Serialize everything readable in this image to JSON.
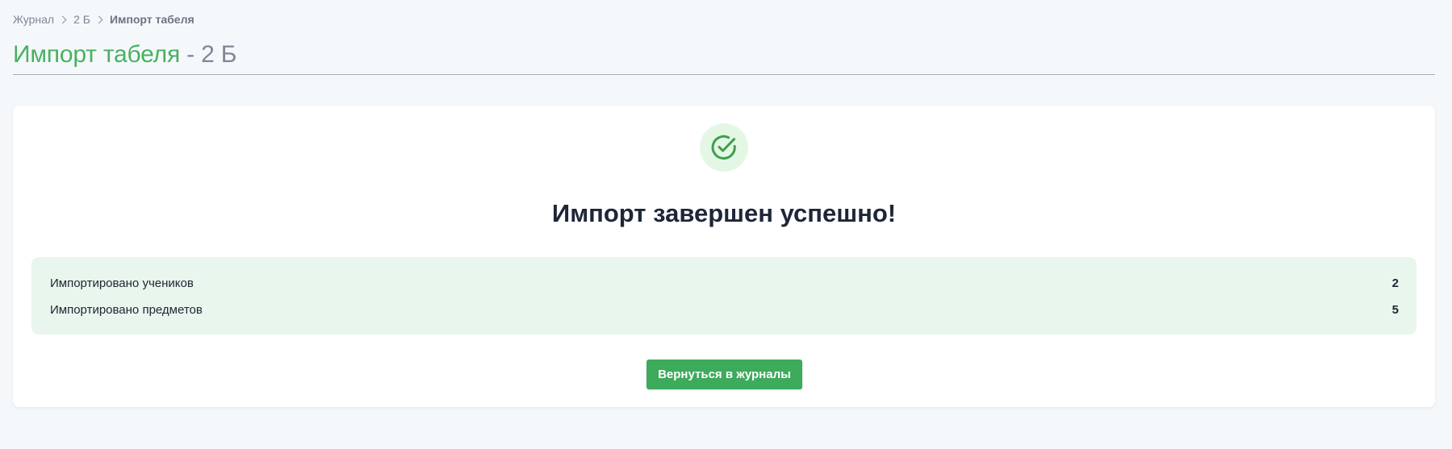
{
  "breadcrumb": {
    "items": [
      "Журнал",
      "2 Б",
      "Импорт табеля"
    ]
  },
  "header": {
    "title": "Импорт табеля",
    "separator": "-",
    "class_name": "2 Б"
  },
  "result": {
    "icon": "check-circle-icon",
    "heading": "Импорт завершен успешно!",
    "stats": [
      {
        "label": "Импортировано учеников",
        "value": "2"
      },
      {
        "label": "Импортировано предметов",
        "value": "5"
      }
    ],
    "button_label": "Вернуться в журналы"
  },
  "colors": {
    "accent": "#48b160",
    "button": "#3daa5c",
    "badge_bg": "#e3f7e4",
    "panel_bg": "#e9f6ed",
    "page_bg": "#f5f8fb"
  }
}
